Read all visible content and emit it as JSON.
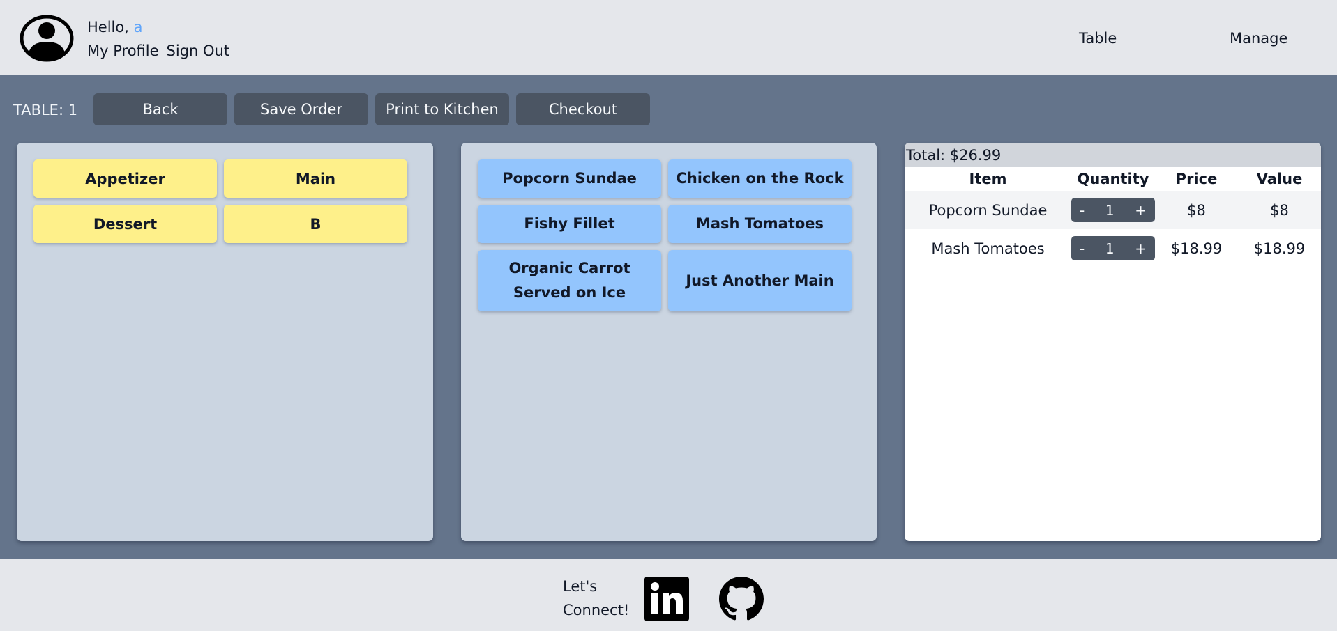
{
  "header": {
    "greeting": "Hello,",
    "username": "a",
    "profile_links": [
      "My Profile",
      "Sign Out"
    ],
    "nav": [
      "Table",
      "Manage"
    ]
  },
  "toolbar": {
    "table_label": "TABLE: 1",
    "buttons": [
      "Back",
      "Save Order",
      "Print to Kitchen",
      "Checkout"
    ]
  },
  "categories": [
    "Appetizer",
    "Main",
    "Dessert",
    "B"
  ],
  "menu_items": [
    "Popcorn Sundae",
    "Chicken on the Rock",
    "Fishy Fillet",
    "Mash Tomatoes",
    "Organic Carrot Served on Ice",
    "Just Another Main"
  ],
  "order": {
    "total": "Total: $26.99",
    "columns": [
      "Item",
      "Quantity",
      "Price",
      "Value"
    ],
    "rows": [
      {
        "item": "Popcorn Sundae",
        "qty": "1",
        "price": "$8",
        "value": "$8"
      },
      {
        "item": "Mash Tomatoes",
        "qty": "1",
        "price": "$18.99",
        "value": "$18.99"
      }
    ],
    "minus": "-",
    "plus": "+"
  },
  "footer": {
    "connect_line1": "Let's",
    "connect_line2": "Connect!"
  },
  "colors": {
    "header_bg": "#e5e7eb",
    "main_bg": "#64748b",
    "button_dark": "#4b5563",
    "category_yellow": "#fef08a",
    "item_blue": "#93c5fd",
    "panel_bg": "#cbd5e1",
    "username_blue": "#60a5fa"
  }
}
